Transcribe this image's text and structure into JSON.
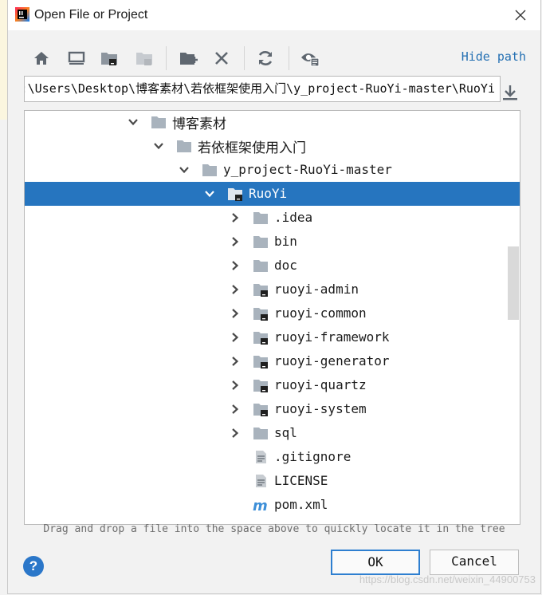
{
  "window": {
    "title": "Open File or Project"
  },
  "toolbar": {
    "icons": [
      "home-icon",
      "desktop-icon",
      "project-folder-icon",
      "module-folder-icon",
      "new-folder-icon",
      "delete-icon",
      "refresh-icon",
      "show-hidden-icon"
    ],
    "hide_path_label": "Hide path"
  },
  "path": {
    "value": "C:\\Users\\Desktop\\博客素材\\若依框架使用入门\\y_project-RuoYi-master\\RuoYi"
  },
  "tree": {
    "items": [
      {
        "label": "博客素材",
        "depth": 0,
        "expanded": true,
        "type": "folder",
        "cjk": true
      },
      {
        "label": "若依框架使用入门",
        "depth": 1,
        "expanded": true,
        "type": "folder",
        "cjk": true
      },
      {
        "label": "y_project-RuoYi-master",
        "depth": 2,
        "expanded": true,
        "type": "folder"
      },
      {
        "label": "RuoYi",
        "depth": 3,
        "expanded": true,
        "type": "module",
        "selected": true
      },
      {
        "label": ".idea",
        "depth": 4,
        "expanded": false,
        "type": "folder"
      },
      {
        "label": "bin",
        "depth": 4,
        "expanded": false,
        "type": "folder"
      },
      {
        "label": "doc",
        "depth": 4,
        "expanded": false,
        "type": "folder"
      },
      {
        "label": "ruoyi-admin",
        "depth": 4,
        "expanded": false,
        "type": "module"
      },
      {
        "label": "ruoyi-common",
        "depth": 4,
        "expanded": false,
        "type": "module"
      },
      {
        "label": "ruoyi-framework",
        "depth": 4,
        "expanded": false,
        "type": "module"
      },
      {
        "label": "ruoyi-generator",
        "depth": 4,
        "expanded": false,
        "type": "module"
      },
      {
        "label": "ruoyi-quartz",
        "depth": 4,
        "expanded": false,
        "type": "module"
      },
      {
        "label": "ruoyi-system",
        "depth": 4,
        "expanded": false,
        "type": "module"
      },
      {
        "label": "sql",
        "depth": 4,
        "expanded": false,
        "type": "folder"
      },
      {
        "label": ".gitignore",
        "depth": 4,
        "type": "file"
      },
      {
        "label": "LICENSE",
        "depth": 4,
        "type": "file"
      },
      {
        "label": "pom.xml",
        "depth": 4,
        "type": "maven"
      }
    ]
  },
  "hint": "Drag and drop a file into the space above to quickly locate it in the tree",
  "buttons": {
    "help": "?",
    "ok": "OK",
    "cancel": "Cancel"
  },
  "watermark": "https://blog.csdn.net/weixin_44900753",
  "colors": {
    "selection": "#2675bf",
    "link": "#2470b3",
    "folder": "#a9b3bd",
    "icon": "#5f6770"
  }
}
